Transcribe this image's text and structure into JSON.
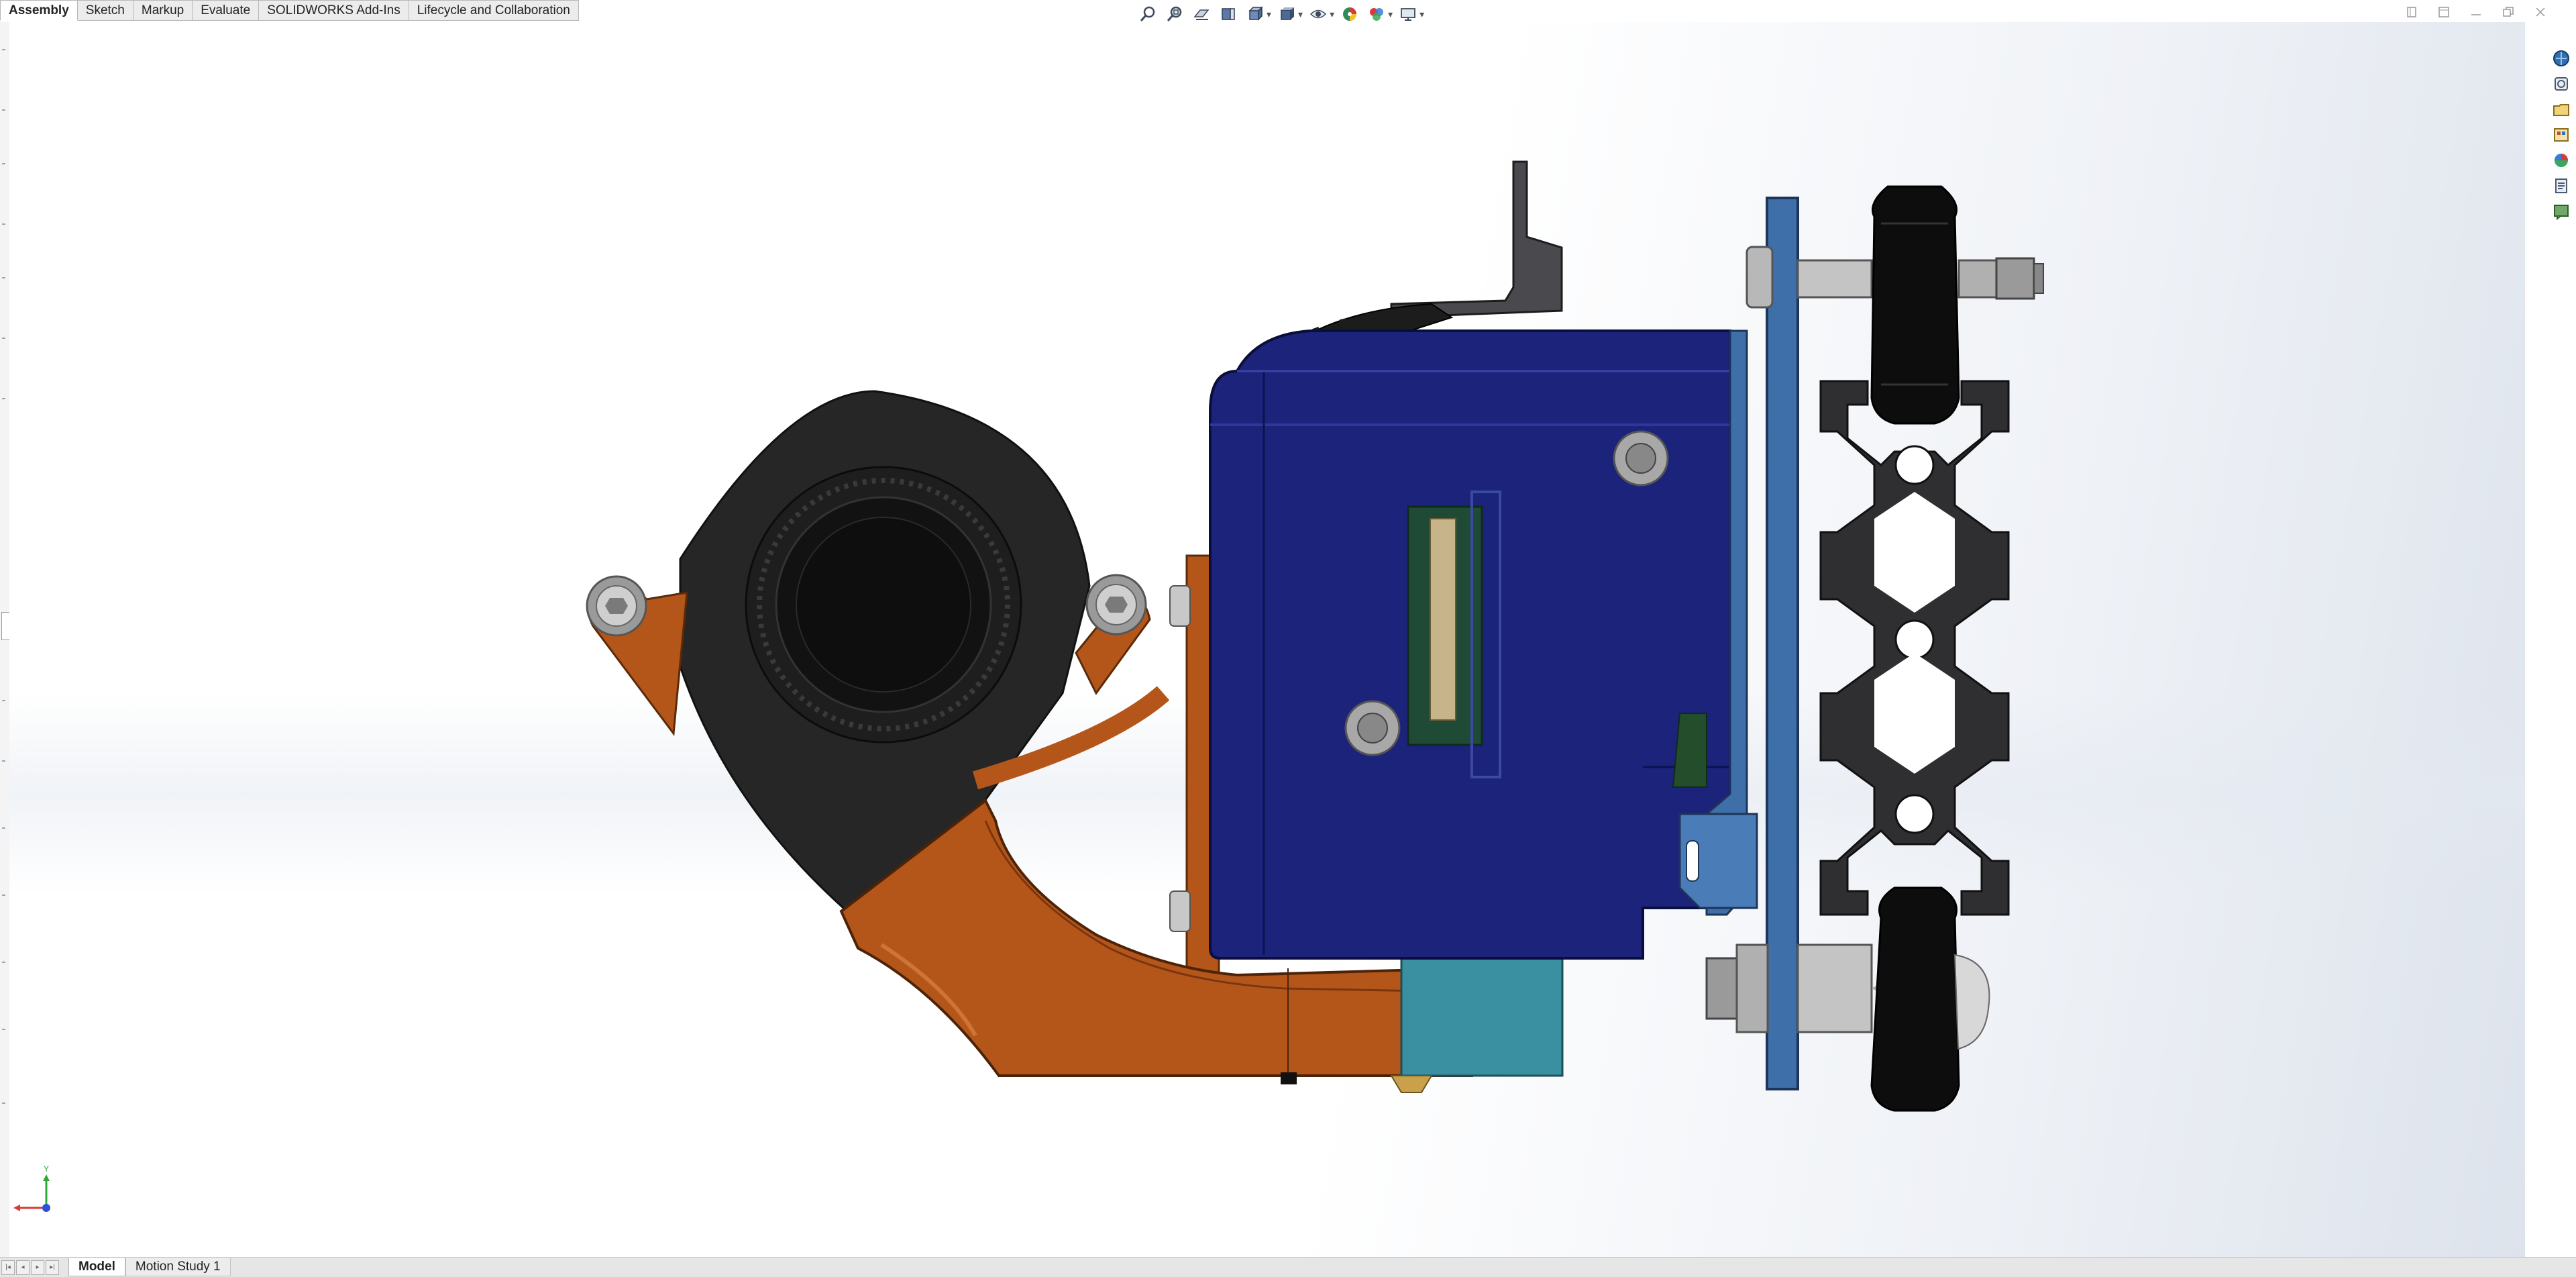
{
  "command_tabs": [
    {
      "label": "Assembly",
      "active": true
    },
    {
      "label": "Sketch",
      "active": false
    },
    {
      "label": "Markup",
      "active": false
    },
    {
      "label": "Evaluate",
      "active": false
    },
    {
      "label": "SOLIDWORKS Add-Ins",
      "active": false
    },
    {
      "label": "Lifecycle and Collaboration",
      "active": false
    }
  ],
  "view_toolbar_icons": [
    "zoom-to-fit-icon",
    "zoom-to-area-icon",
    "previous-view-icon",
    "section-view-icon",
    "view-orientation-icon",
    "display-style-icon",
    "hide-show-items-icon",
    "edit-appearance-icon",
    "apply-scene-icon",
    "view-settings-icon"
  ],
  "task_pane_icons": [
    "solidworks-resources-icon",
    "design-library-icon",
    "file-explorer-icon",
    "view-palette-icon",
    "appearances-icon",
    "custom-properties-icon",
    "solidworks-forum-icon"
  ],
  "triad": {
    "y_label": "Y"
  },
  "bottom_tabs": [
    {
      "label": "Model",
      "active": true
    },
    {
      "label": "Motion Study 1",
      "active": false
    }
  ],
  "colors": {
    "stepper_body": "#1c237a",
    "shroud_copper": "#b4561a",
    "fan_black": "#262626",
    "plate_blue": "#3f6fa8",
    "extrusion_dark": "#2f2f32",
    "heater_teal": "#3a8fa0"
  }
}
